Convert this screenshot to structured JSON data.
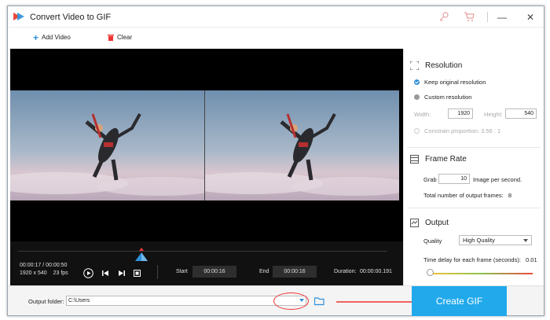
{
  "window": {
    "title": "Convert Video to GIF",
    "controls": [
      "minimize-icon",
      "maximize-icon",
      "close-icon"
    ],
    "extra_icons": [
      "key-icon",
      "cart-icon"
    ]
  },
  "toolbar": {
    "add_label": "Add Video",
    "clear_label": "Clear"
  },
  "player": {
    "current_time": "00:00:17",
    "time_separator": "/",
    "total_time": "00:00:50",
    "resolution": "1920 x 540",
    "fps": "23 fps",
    "start_label": "Start",
    "start_value": "00:00:16",
    "end_label": "End",
    "end_value": "00:00:16",
    "duration_label": "Duration:",
    "duration_value": "00:00:00.191"
  },
  "resolution": {
    "title": "Resolution",
    "option_keep": "Keep original resolution",
    "option_custom": "Custom resolution",
    "width_label": "Width:",
    "width_value": "1920",
    "height_label": "Height:",
    "height_value": "540",
    "constrain_label": "Constrain proportion: 3.56 : 1"
  },
  "frame_rate": {
    "title": "Frame Rate",
    "grab_label": "Grab",
    "grab_value": "10",
    "per_second_label": "Image per second.",
    "total_label": "Total number of output frames:",
    "total_value": "8"
  },
  "output": {
    "title": "Output",
    "quality_label": "Quality",
    "quality_value": "High Quality",
    "delay_label": "Time delay for each frame (seconds):",
    "delay_value": "0.01"
  },
  "footer": {
    "folder_label": "Output folder:",
    "folder_value": "C:\\Users",
    "create_label": "Create GIF"
  },
  "colors": {
    "accent": "#21a9ec",
    "annotation": "#e33333"
  }
}
